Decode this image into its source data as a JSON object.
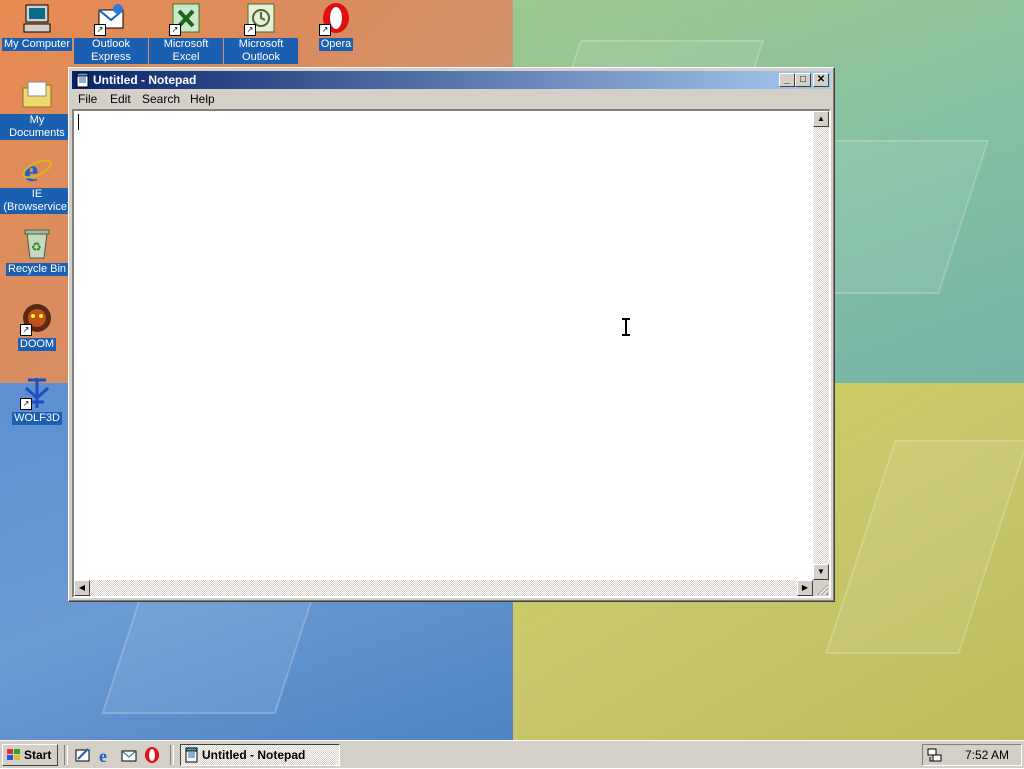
{
  "desktop": {
    "icons": [
      {
        "label": "My Computer"
      },
      {
        "label": "Outlook Express"
      },
      {
        "label": "Microsoft Excel"
      },
      {
        "label": "Microsoft Outlook"
      },
      {
        "label": "Opera"
      },
      {
        "label": "My Documents"
      },
      {
        "label": "IE (Browservice)"
      },
      {
        "label": "Recycle Bin"
      },
      {
        "label": "DOOM"
      },
      {
        "label": "WOLF3D"
      }
    ]
  },
  "window": {
    "title": "Untitled - Notepad",
    "menu": [
      "File",
      "Edit",
      "Search",
      "Help"
    ],
    "content": ""
  },
  "taskbar": {
    "start_label": "Start",
    "task_label": "Untitled - Notepad",
    "clock": "7:52 AM"
  },
  "colors": {
    "titlebar_start": "#0a246a",
    "titlebar_end": "#a6caf0",
    "icon_label_bg": "#1a5fb0",
    "chrome": "#d4d0c8"
  }
}
